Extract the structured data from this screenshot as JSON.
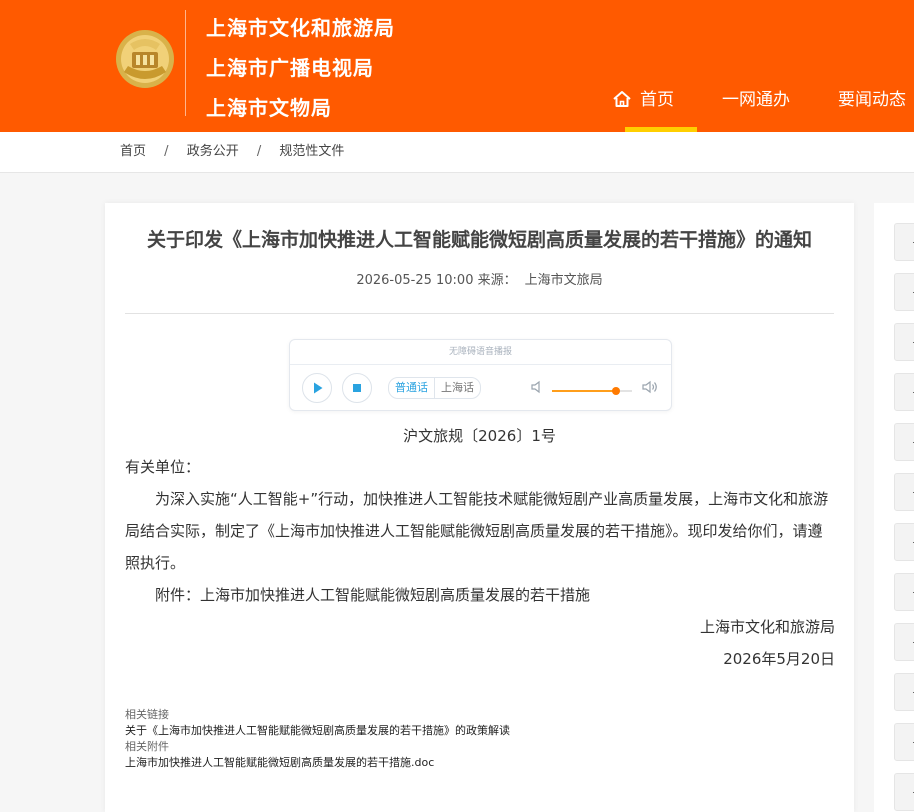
{
  "header": {
    "org_names": [
      "上海市文化和旅游局",
      "上海市广播电视局",
      "上海市文物局"
    ],
    "logo_icon": "shanghai-emblem-icon",
    "nav": [
      {
        "label": "首页",
        "icon": "home-icon",
        "active": true
      },
      {
        "label": "一网通办"
      },
      {
        "label": "要闻动态"
      }
    ],
    "colors": {
      "brand": "#ff5a00",
      "active_underline": "#ffcf00"
    }
  },
  "breadcrumb": {
    "items": [
      "首页",
      "政务公开",
      "规范性文件"
    ],
    "separator": "/"
  },
  "article": {
    "title": "关于印发《上海市加快推进人工智能赋能微短剧高质量发展的若干措施》的通知",
    "datetime": "2026-05-25 10:00",
    "source_label": "来源：",
    "source_value": "上海市文旅局",
    "doc_number": "沪文旅规〔2026〕1号",
    "addressee": "有关单位：",
    "paragraph": "为深入实施“人工智能+”行动，加快推进人工智能技术赋能微短剧产业高质量发展，上海市文化和旅游局结合实际，制定了《上海市加快推进人工智能赋能微短剧高质量发展的若干措施》。现印发给你们，请遵照执行。",
    "attachment": "附件：上海市加快推进人工智能赋能微短剧高质量发展的若干措施",
    "signature": "上海市文化和旅游局",
    "date": "2026年5月20日"
  },
  "player": {
    "header": "无障碍语音播报",
    "languages": [
      {
        "label": "普通话",
        "active": true
      },
      {
        "label": "上海话",
        "active": false
      }
    ],
    "volume": 0.8,
    "colors": {
      "accent": "#2aa3e0",
      "volume": "#ff7a00"
    },
    "icons": {
      "play": "play-icon",
      "stop": "stop-icon",
      "volume_low": "volume-low-icon",
      "volume_high": "volume-high-icon"
    }
  },
  "related": {
    "links_label": "相关链接",
    "link": "关于《上海市加快推进人工智能赋能微短剧高质量发展的若干措施》的政策解读",
    "attachments_label": "相关附件",
    "attachment_file": "上海市加快推进人工智能赋能微短剧高质量发展的若干措施.doc"
  },
  "sidebar": {
    "tab_count": 12,
    "tab_icon": "dash-icon"
  }
}
